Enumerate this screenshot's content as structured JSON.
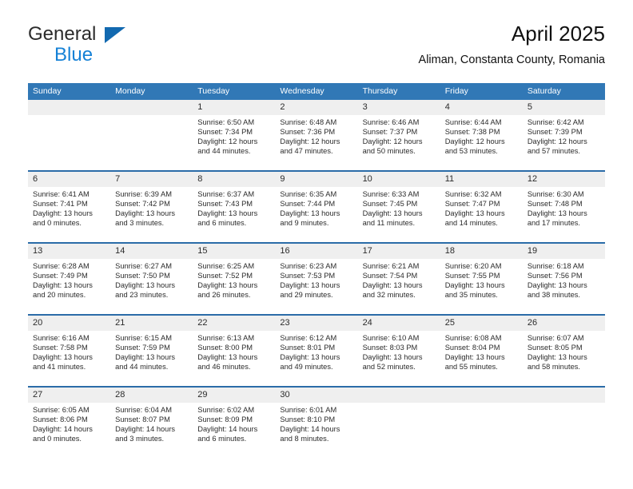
{
  "brand": {
    "line1": "General",
    "line2": "Blue",
    "triangle_icon": "triangle-logo-icon",
    "color_line2": "#1581d6",
    "color_triangle": "#1269b0"
  },
  "header": {
    "title": "April 2025",
    "subtitle": "Aliman, Constanta County, Romania"
  },
  "theme": {
    "header_blue": "#3178b6",
    "rule_blue": "#2b6ca8",
    "daynum_gray": "#efefef"
  },
  "weekday_headers": [
    "Sunday",
    "Monday",
    "Tuesday",
    "Wednesday",
    "Thursday",
    "Friday",
    "Saturday"
  ],
  "weeks": [
    [
      {
        "day": "",
        "sunrise": "",
        "sunset": "",
        "daylight_line1": "",
        "daylight_line2": ""
      },
      {
        "day": "",
        "sunrise": "",
        "sunset": "",
        "daylight_line1": "",
        "daylight_line2": ""
      },
      {
        "day": "1",
        "sunrise": "Sunrise: 6:50 AM",
        "sunset": "Sunset: 7:34 PM",
        "daylight_line1": "Daylight: 12 hours",
        "daylight_line2": "and 44 minutes."
      },
      {
        "day": "2",
        "sunrise": "Sunrise: 6:48 AM",
        "sunset": "Sunset: 7:36 PM",
        "daylight_line1": "Daylight: 12 hours",
        "daylight_line2": "and 47 minutes."
      },
      {
        "day": "3",
        "sunrise": "Sunrise: 6:46 AM",
        "sunset": "Sunset: 7:37 PM",
        "daylight_line1": "Daylight: 12 hours",
        "daylight_line2": "and 50 minutes."
      },
      {
        "day": "4",
        "sunrise": "Sunrise: 6:44 AM",
        "sunset": "Sunset: 7:38 PM",
        "daylight_line1": "Daylight: 12 hours",
        "daylight_line2": "and 53 minutes."
      },
      {
        "day": "5",
        "sunrise": "Sunrise: 6:42 AM",
        "sunset": "Sunset: 7:39 PM",
        "daylight_line1": "Daylight: 12 hours",
        "daylight_line2": "and 57 minutes."
      }
    ],
    [
      {
        "day": "6",
        "sunrise": "Sunrise: 6:41 AM",
        "sunset": "Sunset: 7:41 PM",
        "daylight_line1": "Daylight: 13 hours",
        "daylight_line2": "and 0 minutes."
      },
      {
        "day": "7",
        "sunrise": "Sunrise: 6:39 AM",
        "sunset": "Sunset: 7:42 PM",
        "daylight_line1": "Daylight: 13 hours",
        "daylight_line2": "and 3 minutes."
      },
      {
        "day": "8",
        "sunrise": "Sunrise: 6:37 AM",
        "sunset": "Sunset: 7:43 PM",
        "daylight_line1": "Daylight: 13 hours",
        "daylight_line2": "and 6 minutes."
      },
      {
        "day": "9",
        "sunrise": "Sunrise: 6:35 AM",
        "sunset": "Sunset: 7:44 PM",
        "daylight_line1": "Daylight: 13 hours",
        "daylight_line2": "and 9 minutes."
      },
      {
        "day": "10",
        "sunrise": "Sunrise: 6:33 AM",
        "sunset": "Sunset: 7:45 PM",
        "daylight_line1": "Daylight: 13 hours",
        "daylight_line2": "and 11 minutes."
      },
      {
        "day": "11",
        "sunrise": "Sunrise: 6:32 AM",
        "sunset": "Sunset: 7:47 PM",
        "daylight_line1": "Daylight: 13 hours",
        "daylight_line2": "and 14 minutes."
      },
      {
        "day": "12",
        "sunrise": "Sunrise: 6:30 AM",
        "sunset": "Sunset: 7:48 PM",
        "daylight_line1": "Daylight: 13 hours",
        "daylight_line2": "and 17 minutes."
      }
    ],
    [
      {
        "day": "13",
        "sunrise": "Sunrise: 6:28 AM",
        "sunset": "Sunset: 7:49 PM",
        "daylight_line1": "Daylight: 13 hours",
        "daylight_line2": "and 20 minutes."
      },
      {
        "day": "14",
        "sunrise": "Sunrise: 6:27 AM",
        "sunset": "Sunset: 7:50 PM",
        "daylight_line1": "Daylight: 13 hours",
        "daylight_line2": "and 23 minutes."
      },
      {
        "day": "15",
        "sunrise": "Sunrise: 6:25 AM",
        "sunset": "Sunset: 7:52 PM",
        "daylight_line1": "Daylight: 13 hours",
        "daylight_line2": "and 26 minutes."
      },
      {
        "day": "16",
        "sunrise": "Sunrise: 6:23 AM",
        "sunset": "Sunset: 7:53 PM",
        "daylight_line1": "Daylight: 13 hours",
        "daylight_line2": "and 29 minutes."
      },
      {
        "day": "17",
        "sunrise": "Sunrise: 6:21 AM",
        "sunset": "Sunset: 7:54 PM",
        "daylight_line1": "Daylight: 13 hours",
        "daylight_line2": "and 32 minutes."
      },
      {
        "day": "18",
        "sunrise": "Sunrise: 6:20 AM",
        "sunset": "Sunset: 7:55 PM",
        "daylight_line1": "Daylight: 13 hours",
        "daylight_line2": "and 35 minutes."
      },
      {
        "day": "19",
        "sunrise": "Sunrise: 6:18 AM",
        "sunset": "Sunset: 7:56 PM",
        "daylight_line1": "Daylight: 13 hours",
        "daylight_line2": "and 38 minutes."
      }
    ],
    [
      {
        "day": "20",
        "sunrise": "Sunrise: 6:16 AM",
        "sunset": "Sunset: 7:58 PM",
        "daylight_line1": "Daylight: 13 hours",
        "daylight_line2": "and 41 minutes."
      },
      {
        "day": "21",
        "sunrise": "Sunrise: 6:15 AM",
        "sunset": "Sunset: 7:59 PM",
        "daylight_line1": "Daylight: 13 hours",
        "daylight_line2": "and 44 minutes."
      },
      {
        "day": "22",
        "sunrise": "Sunrise: 6:13 AM",
        "sunset": "Sunset: 8:00 PM",
        "daylight_line1": "Daylight: 13 hours",
        "daylight_line2": "and 46 minutes."
      },
      {
        "day": "23",
        "sunrise": "Sunrise: 6:12 AM",
        "sunset": "Sunset: 8:01 PM",
        "daylight_line1": "Daylight: 13 hours",
        "daylight_line2": "and 49 minutes."
      },
      {
        "day": "24",
        "sunrise": "Sunrise: 6:10 AM",
        "sunset": "Sunset: 8:03 PM",
        "daylight_line1": "Daylight: 13 hours",
        "daylight_line2": "and 52 minutes."
      },
      {
        "day": "25",
        "sunrise": "Sunrise: 6:08 AM",
        "sunset": "Sunset: 8:04 PM",
        "daylight_line1": "Daylight: 13 hours",
        "daylight_line2": "and 55 minutes."
      },
      {
        "day": "26",
        "sunrise": "Sunrise: 6:07 AM",
        "sunset": "Sunset: 8:05 PM",
        "daylight_line1": "Daylight: 13 hours",
        "daylight_line2": "and 58 minutes."
      }
    ],
    [
      {
        "day": "27",
        "sunrise": "Sunrise: 6:05 AM",
        "sunset": "Sunset: 8:06 PM",
        "daylight_line1": "Daylight: 14 hours",
        "daylight_line2": "and 0 minutes."
      },
      {
        "day": "28",
        "sunrise": "Sunrise: 6:04 AM",
        "sunset": "Sunset: 8:07 PM",
        "daylight_line1": "Daylight: 14 hours",
        "daylight_line2": "and 3 minutes."
      },
      {
        "day": "29",
        "sunrise": "Sunrise: 6:02 AM",
        "sunset": "Sunset: 8:09 PM",
        "daylight_line1": "Daylight: 14 hours",
        "daylight_line2": "and 6 minutes."
      },
      {
        "day": "30",
        "sunrise": "Sunrise: 6:01 AM",
        "sunset": "Sunset: 8:10 PM",
        "daylight_line1": "Daylight: 14 hours",
        "daylight_line2": "and 8 minutes."
      },
      {
        "day": "",
        "sunrise": "",
        "sunset": "",
        "daylight_line1": "",
        "daylight_line2": ""
      },
      {
        "day": "",
        "sunrise": "",
        "sunset": "",
        "daylight_line1": "",
        "daylight_line2": ""
      },
      {
        "day": "",
        "sunrise": "",
        "sunset": "",
        "daylight_line1": "",
        "daylight_line2": ""
      }
    ]
  ]
}
